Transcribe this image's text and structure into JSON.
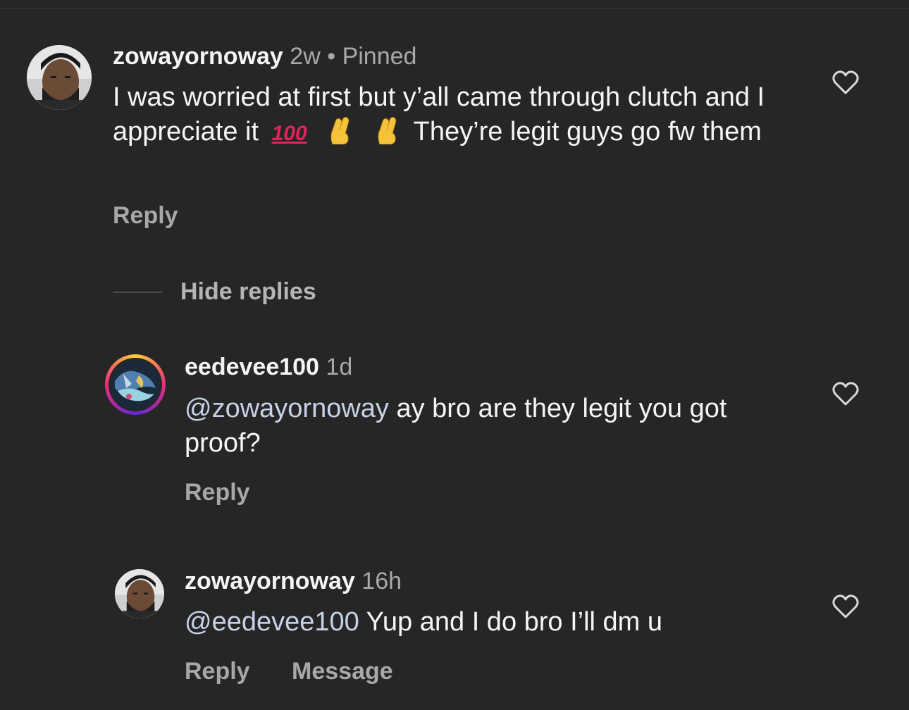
{
  "comments": [
    {
      "username": "zowayornoway",
      "time": "2w",
      "separator": "•",
      "pinned": "Pinned",
      "text_part1": "I was worried at first but y’all came through clutch and I appreciate it",
      "emoji_hundred": "100",
      "emoji_icons": [
        "hundred-points-emoji",
        "crossed-fingers-emoji",
        "crossed-fingers-emoji"
      ],
      "text_part2": "They’re legit guys go fw them",
      "reply_label": "Reply"
    }
  ],
  "hide_replies_label": "Hide replies",
  "replies": [
    {
      "username": "eedevee100",
      "time": "1d",
      "mention": "@zowayornoway",
      "text": "ay bro are they legit you got proof?",
      "reply_label": "Reply"
    },
    {
      "username": "zowayornoway",
      "time": "16h",
      "mention": "@eedevee100",
      "text": "Yup and I do bro I’ll dm u",
      "reply_label": "Reply",
      "message_label": "Message"
    }
  ],
  "icons": [
    "heart-icon",
    "avatar"
  ],
  "colors": {
    "background": "#262626",
    "text": "#f5f5f5",
    "secondary": "#a8a8a8",
    "mention": "#c7d2e8",
    "story_ring": "#d62976"
  }
}
